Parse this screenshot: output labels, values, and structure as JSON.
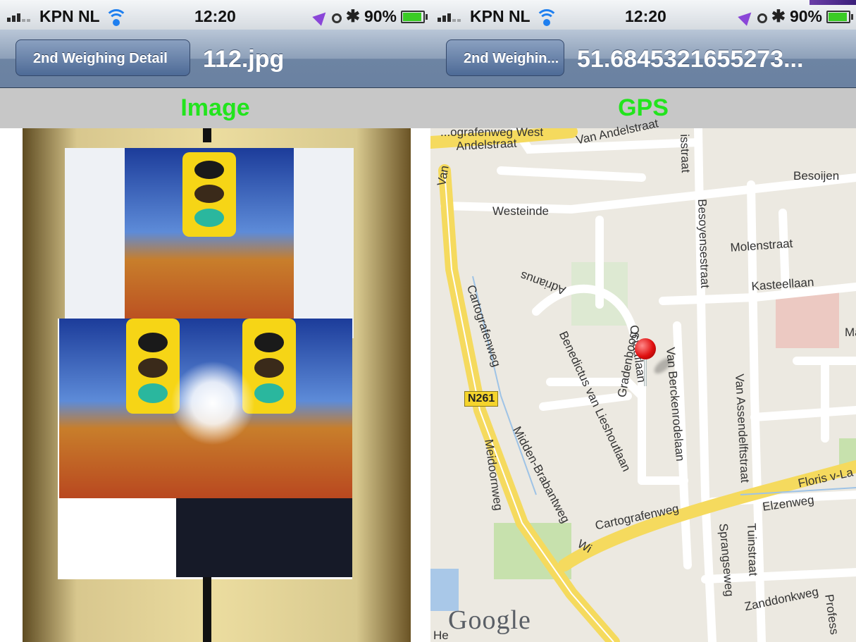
{
  "status_bar_left": {
    "carrier": "KPN NL",
    "time": "12:20",
    "battery": "90%"
  },
  "status_bar_right": {
    "carrier": "KPN NL",
    "time": "12:20",
    "battery": "90%"
  },
  "left_screen": {
    "back_label": "2nd Weighing Detail",
    "title": "112.jpg",
    "section_header": "Image"
  },
  "right_screen": {
    "back_label": "2nd Weighin...",
    "title": "51.6845321655273...",
    "section_header": "GPS",
    "map": {
      "labels": {
        "cartografenweg_west": "...ografenweg West",
        "van_andelstraat_1": "Van Andelstraat",
        "van_andelstraat_2": "Andelstraat",
        "van": "Van",
        "besoijen": "Besoijen",
        "westeinde": "Westeinde",
        "molenstraat": "Molenstraat",
        "kasteellaan": "Kasteellaan",
        "besoyensestraat": "Besoyensestraat",
        "cartografenweg_vertical": "Cartografenweg",
        "adrianus": "Adrianus",
        "benedictus": "Benedictus van Lieshoutlaan",
        "gradenboog": "Gradenboog",
        "octaaflaan": "Octaaflaan",
        "van_berckenrodelaan": "Van Berckenrodelaan",
        "van_assendelftstraat": "Van Assendelftstraat",
        "n261": "N261",
        "meidoornweg": "Meidoornweg",
        "midden_brabantweg": "Midden-Brabantweg",
        "floris": "Floris v-La",
        "elzenweg": "Elzenweg",
        "cartografenweg_horizontal": "Cartografenweg",
        "sprangseweg": "Sprangseweg",
        "tuinstraat": "Tuinstraat",
        "zanddonkweg": "Zanddonkweg",
        "profess": "Profess",
        "ma": "Ma",
        "wi": "Wi",
        "he": "He",
        "isstraat": "isstraat",
        "google": "Google"
      }
    }
  },
  "colors": {
    "section_header_text": "#22e41d",
    "section_header_bg": "#c7c7c7",
    "nav_bar": "#7189a8",
    "pin": "#e01010",
    "major_road": "#f7e27a"
  },
  "icons": [
    "signal-bars-icon",
    "wifi-icon",
    "location-arrow-icon",
    "clock-icon",
    "bluetooth-icon",
    "battery-charging-icon",
    "back-chevron-icon",
    "map-pin-icon"
  ]
}
